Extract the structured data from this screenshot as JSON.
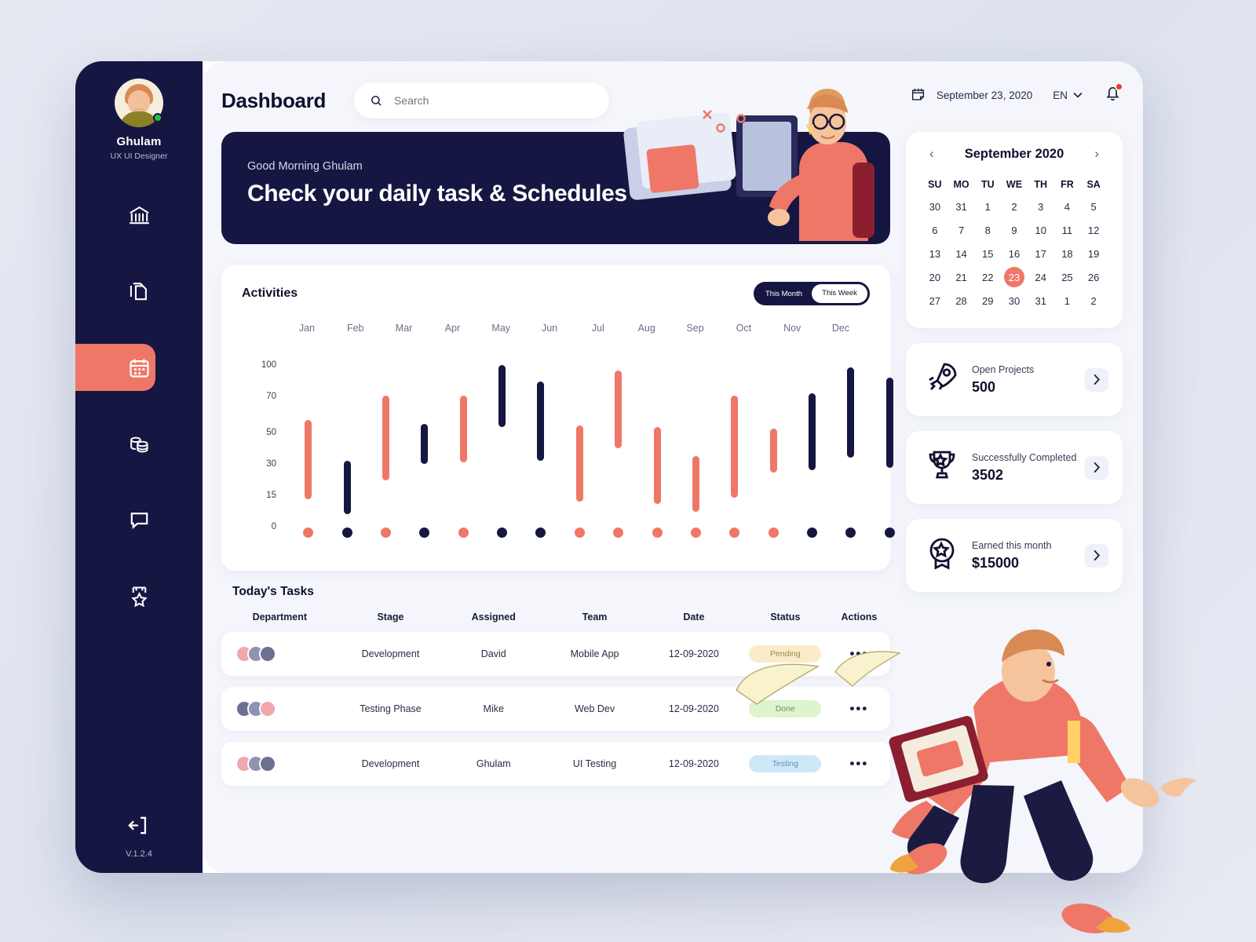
{
  "sidebar": {
    "user": {
      "name": "Ghulam",
      "role": "UX UI Designer"
    },
    "items": [
      {
        "icon": "bank-icon",
        "active": false
      },
      {
        "icon": "documents-icon",
        "active": false
      },
      {
        "icon": "calendar-icon",
        "active": true
      },
      {
        "icon": "coins-icon",
        "active": false
      },
      {
        "icon": "chat-icon",
        "active": false
      },
      {
        "icon": "medal-icon",
        "active": false
      }
    ],
    "logout_icon": "logout-icon",
    "version": "V.1.2.4"
  },
  "header": {
    "title": "Dashboard",
    "search_placeholder": "Search",
    "search_value": "",
    "date": "September 23, 2020",
    "language": "EN"
  },
  "banner": {
    "greeting": "Good Morning Ghulam",
    "title": "Check your daily task & Schedules"
  },
  "activities": {
    "title": "Activities",
    "toggle": {
      "month": "This Month",
      "week": "This Week",
      "active": "This Week"
    }
  },
  "chart_data": {
    "type": "bar",
    "title": "Activities",
    "xlabel": "",
    "ylabel": "",
    "categories": [
      "Jan",
      "Feb",
      "Mar",
      "Apr",
      "May",
      "Jun",
      "Jul",
      "Aug",
      "Sep",
      "Oct",
      "Nov",
      "Dec"
    ],
    "ytick_labels": [
      "100",
      "70",
      "50",
      "30",
      "15",
      "0"
    ],
    "ytick_values": [
      100,
      70,
      50,
      30,
      15,
      0
    ],
    "ylim": [
      0,
      110
    ],
    "grid": false,
    "legend": false,
    "colors": {
      "coral": "#ef7768",
      "navy": "#161643"
    },
    "note": "Floating range bars with rounded caps; each bar defined by low/high value. Baseline dot markers below axis.",
    "bars": [
      {
        "index": 0,
        "color": "coral",
        "low": 13,
        "high": 57
      },
      {
        "index": 1,
        "color": "navy",
        "low": 6,
        "high": 32
      },
      {
        "index": 2,
        "color": "coral",
        "low": 22,
        "high": 71
      },
      {
        "index": 3,
        "color": "navy",
        "low": 30,
        "high": 55
      },
      {
        "index": 4,
        "color": "coral",
        "low": 31,
        "high": 71
      },
      {
        "index": 5,
        "color": "navy",
        "low": 53,
        "high": 100
      },
      {
        "index": 6,
        "color": "navy",
        "low": 32,
        "high": 84
      },
      {
        "index": 7,
        "color": "coral",
        "low": 12,
        "high": 54
      },
      {
        "index": 8,
        "color": "coral",
        "low": 40,
        "high": 95
      },
      {
        "index": 9,
        "color": "coral",
        "low": 11,
        "high": 53
      },
      {
        "index": 10,
        "color": "coral",
        "low": 7,
        "high": 35
      },
      {
        "index": 11,
        "color": "coral",
        "low": 14,
        "high": 71
      },
      {
        "index": 12,
        "color": "coral",
        "low": 26,
        "high": 52
      },
      {
        "index": 13,
        "color": "navy",
        "low": 27,
        "high": 73
      },
      {
        "index": 14,
        "color": "navy",
        "low": 34,
        "high": 98
      },
      {
        "index": 15,
        "color": "navy",
        "low": 28,
        "high": 88
      }
    ],
    "baseline_dots": [
      "coral",
      "navy",
      "coral",
      "navy",
      "coral",
      "navy",
      "navy",
      "coral",
      "coral",
      "coral",
      "coral",
      "coral",
      "coral",
      "navy",
      "navy",
      "navy"
    ]
  },
  "tasks": {
    "title": "Today's Tasks",
    "columns": [
      "Department",
      "Stage",
      "Assigned",
      "Team",
      "Date",
      "Status",
      "Actions"
    ],
    "rows": [
      {
        "stage": "Development",
        "assigned": "David",
        "team": "Mobile App",
        "date": "12-09-2020",
        "status": "Pending",
        "status_color": "#faecc8",
        "status_text_color": "#9a8a53",
        "avatars": [
          "#f2a7ae",
          "#8e93b2",
          "#6f6f92"
        ],
        "actions": "•••"
      },
      {
        "stage": "Testing Phase",
        "assigned": "Mike",
        "team": "Web Dev",
        "date": "12-09-2020",
        "status": "Done",
        "status_color": "#ddf4cf",
        "status_text_color": "#6d9060",
        "avatars": [
          "#6f6f92",
          "#8e93b2",
          "#f2a7ae"
        ],
        "actions": "•••"
      },
      {
        "stage": "Development",
        "assigned": "Ghulam",
        "team": "UI Testing",
        "date": "12-09-2020",
        "status": "Testing",
        "status_color": "#cfe8f8",
        "status_text_color": "#6090ad",
        "avatars": [
          "#f2a7ae",
          "#8e93b2",
          "#6f6f92"
        ],
        "actions": "•••"
      }
    ]
  },
  "calendar": {
    "month_label": "September 2020",
    "prev_icon": "chevron-left-icon",
    "next_icon": "chevron-right-icon",
    "dow": [
      "SU",
      "MO",
      "TU",
      "WE",
      "TH",
      "FR",
      "SA"
    ],
    "weeks": [
      [
        "30",
        "31",
        "1",
        "2",
        "3",
        "4",
        "5"
      ],
      [
        "6",
        "7",
        "8",
        "9",
        "10",
        "11",
        "12"
      ],
      [
        "13",
        "14",
        "15",
        "16",
        "17",
        "18",
        "19"
      ],
      [
        "20",
        "21",
        "22",
        "23",
        "24",
        "25",
        "26"
      ],
      [
        "27",
        "28",
        "29",
        "30",
        "31",
        "1",
        "2"
      ]
    ],
    "selected": "23",
    "selected_row": 3,
    "selected_col": 3
  },
  "stats": [
    {
      "icon": "rocket-icon",
      "label": "Open Projects",
      "value": "500",
      "chevron": "chevron-right-icon"
    },
    {
      "icon": "trophy-icon",
      "label": "Successfully Completed",
      "value": "3502",
      "chevron": "chevron-right-icon"
    },
    {
      "icon": "award-badge-icon",
      "label": "Earned this month",
      "value": "$15000",
      "chevron": "chevron-right-icon"
    }
  ],
  "theme": {
    "navy": "#161643",
    "coral": "#ef7768",
    "bg": "#f4f6fb"
  }
}
